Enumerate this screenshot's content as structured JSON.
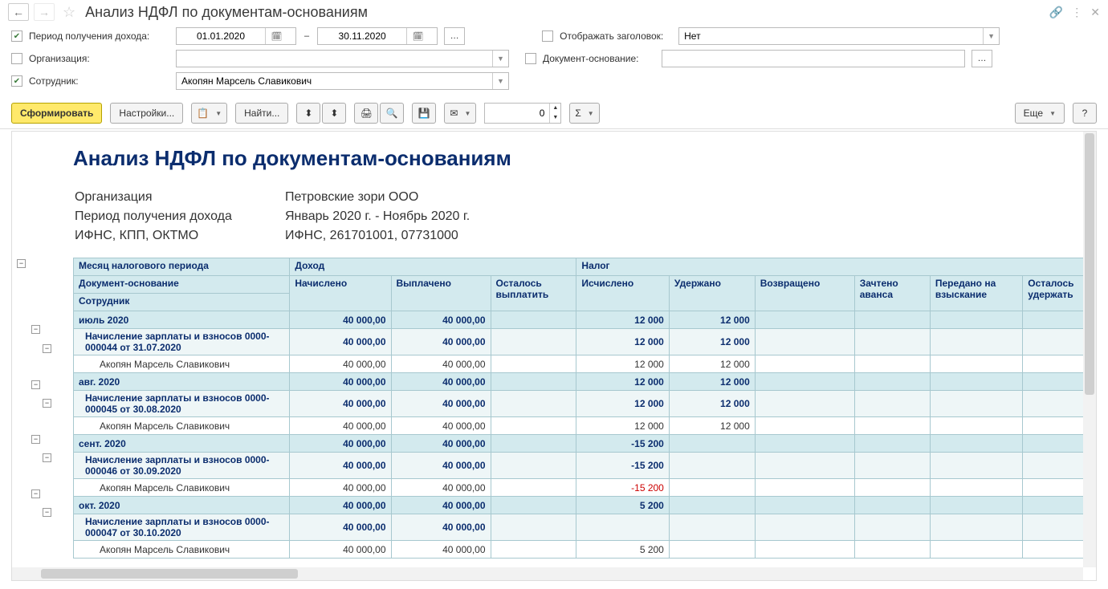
{
  "title": "Анализ НДФЛ по документам-основаниям",
  "filters": {
    "period_label": "Период получения дохода:",
    "date_from": "01.01.2020",
    "date_to": "30.11.2020",
    "show_header_label": "Отображать заголовок:",
    "show_header_value": "Нет",
    "org_label": "Организация:",
    "org_value": "",
    "doc_basis_label": "Документ-основание:",
    "doc_basis_value": "",
    "employee_label": "Сотрудник:",
    "employee_value": "Акопян Марсель Славикович"
  },
  "toolbar": {
    "generate": "Сформировать",
    "settings": "Настройки...",
    "find": "Найти...",
    "number": "0",
    "more": "Еще",
    "help": "?"
  },
  "report": {
    "title": "Анализ НДФЛ по документам-основаниям",
    "meta": {
      "org_label": "Организация",
      "org_value": "Петровские зори ООО",
      "period_label": "Период получения дохода",
      "period_value": "Январь 2020 г. - Ноябрь 2020 г.",
      "ifns_label": "ИФНС, КПП, ОКТМО",
      "ifns_value": "ИФНС, 261701001, 07731000"
    },
    "columns": {
      "month": "Месяц налогового периода",
      "doc": "Документ-основание",
      "emp": "Сотрудник",
      "income": "Доход",
      "tax": "Налог",
      "accrued": "Начислено",
      "paid": "Выплачено",
      "remain_pay": "Осталось выплатить",
      "calculated": "Исчислено",
      "withheld": "Удержано",
      "returned": "Возвращено",
      "offset": "Зачтено аванса",
      "recovery": "Передано на взыскание",
      "remain_hold": "Осталось удержать"
    },
    "rows": [
      {
        "t": "m",
        "name": "июль 2020",
        "v": [
          "40 000,00",
          "40 000,00",
          "",
          "12 000",
          "12 000",
          "",
          "",
          "",
          ""
        ]
      },
      {
        "t": "d",
        "name": "Начисление зарплаты и взносов 0000-000044 от 31.07.2020",
        "v": [
          "40 000,00",
          "40 000,00",
          "",
          "12 000",
          "12 000",
          "",
          "",
          "",
          ""
        ]
      },
      {
        "t": "e",
        "name": "Акопян Марсель Славикович",
        "v": [
          "40 000,00",
          "40 000,00",
          "",
          "12 000",
          "12 000",
          "",
          "",
          "",
          ""
        ]
      },
      {
        "t": "m",
        "name": "авг. 2020",
        "v": [
          "40 000,00",
          "40 000,00",
          "",
          "12 000",
          "12 000",
          "",
          "",
          "",
          ""
        ]
      },
      {
        "t": "d",
        "name": "Начисление зарплаты и взносов 0000-000045 от 30.08.2020",
        "v": [
          "40 000,00",
          "40 000,00",
          "",
          "12 000",
          "12 000",
          "",
          "",
          "",
          ""
        ]
      },
      {
        "t": "e",
        "name": "Акопян Марсель Славикович",
        "v": [
          "40 000,00",
          "40 000,00",
          "",
          "12 000",
          "12 000",
          "",
          "",
          "",
          ""
        ]
      },
      {
        "t": "m",
        "name": "сент. 2020",
        "v": [
          "40 000,00",
          "40 000,00",
          "",
          "-15 200",
          "",
          "",
          "",
          "",
          ""
        ]
      },
      {
        "t": "d",
        "name": "Начисление зарплаты и взносов 0000-000046 от 30.09.2020",
        "v": [
          "40 000,00",
          "40 000,00",
          "",
          "-15 200",
          "",
          "",
          "",
          "",
          ""
        ]
      },
      {
        "t": "e",
        "name": "Акопян Марсель Славикович",
        "v": [
          "40 000,00",
          "40 000,00",
          "",
          "-15 200",
          "",
          "",
          "",
          "",
          ""
        ]
      },
      {
        "t": "m",
        "name": "окт. 2020",
        "v": [
          "40 000,00",
          "40 000,00",
          "",
          "5 200",
          "",
          "",
          "",
          "",
          ""
        ]
      },
      {
        "t": "d",
        "name": "Начисление зарплаты и взносов 0000-000047 от 30.10.2020",
        "v": [
          "40 000,00",
          "40 000,00",
          "",
          "",
          "",
          "",
          "",
          "",
          ""
        ]
      },
      {
        "t": "e",
        "name": "Акопян Марсель Славикович",
        "v": [
          "40 000,00",
          "40 000,00",
          "",
          "5 200",
          "",
          "",
          "",
          "",
          ""
        ]
      }
    ]
  }
}
